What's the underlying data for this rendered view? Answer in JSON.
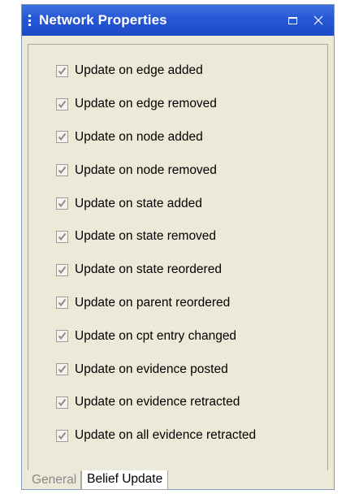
{
  "window": {
    "title": "Network Properties",
    "maximize_icon": "maximize-icon",
    "close_icon": "close-icon"
  },
  "options": [
    {
      "label": "Update on edge added",
      "checked": true
    },
    {
      "label": "Update on edge removed",
      "checked": true
    },
    {
      "label": "Update on node added",
      "checked": true
    },
    {
      "label": "Update on node removed",
      "checked": true
    },
    {
      "label": "Update on state added",
      "checked": true
    },
    {
      "label": "Update on state removed",
      "checked": true
    },
    {
      "label": "Update on state reordered",
      "checked": true
    },
    {
      "label": "Update on parent reordered",
      "checked": true
    },
    {
      "label": "Update on cpt entry changed",
      "checked": true
    },
    {
      "label": "Update on evidence posted",
      "checked": true
    },
    {
      "label": "Update on evidence retracted",
      "checked": true
    },
    {
      "label": "Update on all evidence retracted",
      "checked": true
    }
  ],
  "tabs": [
    {
      "label": "General",
      "active": false
    },
    {
      "label": "Belief Update",
      "active": true
    }
  ],
  "colors": {
    "titlebar": "#2658d6",
    "panel_bg": "#ece9d8",
    "checkmark": "#8c8c8c"
  }
}
